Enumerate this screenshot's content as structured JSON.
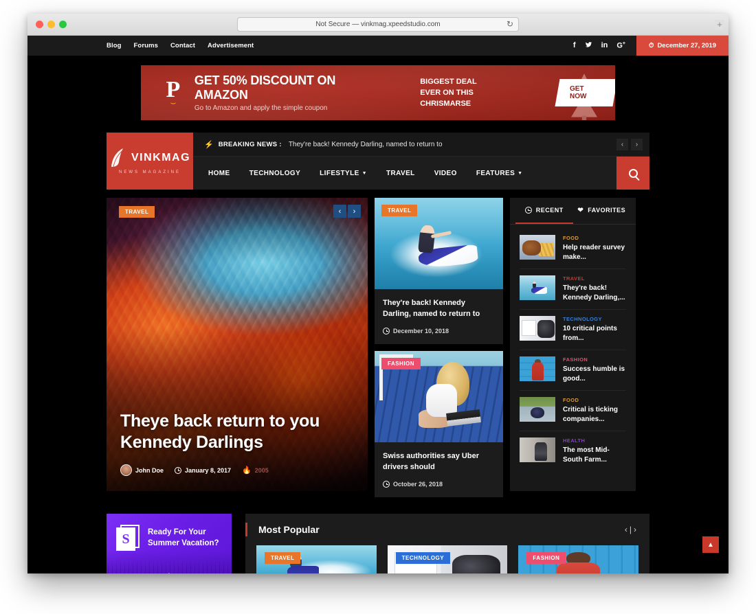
{
  "browser": {
    "url_text": "Not Secure — vinkmag.xpeedstudio.com",
    "reload_icon": "reload-icon",
    "newtab_label": "+"
  },
  "topbar": {
    "links": [
      {
        "label": "Blog"
      },
      {
        "label": "Forums"
      },
      {
        "label": "Contact"
      },
      {
        "label": "Advertisement"
      }
    ],
    "social": [
      {
        "name": "facebook-icon",
        "glyph": "f"
      },
      {
        "name": "twitter-icon",
        "glyph": "🐦"
      },
      {
        "name": "linkedin-icon",
        "glyph": "in"
      },
      {
        "name": "google-plus-icon",
        "glyph": "G+"
      }
    ],
    "date": "December 27, 2019",
    "date_icon": "clock-icon"
  },
  "ad": {
    "brand_glyph": "P",
    "headline": "GET 50% DISCOUNT ON AMAZON",
    "subline": "Go to Amazon and apply the simple coupon",
    "deal_line1": "BIGGEST DEAL",
    "deal_line2": "EVER ON THIS CHRISMARSE",
    "button": "GET NOW"
  },
  "logo": {
    "name": "VINKMAG",
    "tagline": "NEWS MAGAZINE"
  },
  "breaking": {
    "icon": "bolt-icon",
    "label": "BREAKING NEWS :",
    "text": "They're back! Kennedy Darling, named to return to",
    "prev": "‹",
    "next": "›"
  },
  "nav": {
    "items": [
      {
        "label": "HOME",
        "has_dropdown": false
      },
      {
        "label": "TECHNOLOGY",
        "has_dropdown": false
      },
      {
        "label": "LIFESTYLE",
        "has_dropdown": true
      },
      {
        "label": "TRAVEL",
        "has_dropdown": false
      },
      {
        "label": "VIDEO",
        "has_dropdown": false
      },
      {
        "label": "FEATURES",
        "has_dropdown": true
      }
    ],
    "search_icon": "search-icon"
  },
  "hero": {
    "category": "TRAVEL",
    "title": "Theye back return to you Kennedy Darlings",
    "author": "John Doe",
    "date": "January 8, 2017",
    "views": "2005",
    "prev": "‹",
    "next": "›"
  },
  "mid_cards": [
    {
      "category": "TRAVEL",
      "cat_class": "travel",
      "title": "They're back! Kennedy Darling, named to return to",
      "date": "December 10, 2018"
    },
    {
      "category": "FASHION",
      "cat_class": "fashion",
      "title": "Swiss authorities say Uber drivers should",
      "date": "October 26, 2018"
    }
  ],
  "sidebar": {
    "tabs": [
      {
        "label": "RECENT",
        "icon": "clock-icon",
        "active": true
      },
      {
        "label": "FAVORITES",
        "icon": "heart-icon",
        "active": false
      }
    ],
    "items": [
      {
        "category": "FOOD",
        "color": "#d79a3c",
        "title": "Help reader survey make..."
      },
      {
        "category": "TRAVEL",
        "color": "#c9392b",
        "title": "They're back! Kennedy Darling,..."
      },
      {
        "category": "TECHNOLOGY",
        "color": "#3a7fd6",
        "title": "10 critical points from..."
      },
      {
        "category": "FASHION",
        "color": "#e0506e",
        "title": "Success humble is good..."
      },
      {
        "category": "FOOD",
        "color": "#d79a3c",
        "title": "Critical is ticking companies..."
      },
      {
        "category": "HEALTH",
        "color": "#8b3bd4",
        "title": "The most Mid-South Farm..."
      }
    ]
  },
  "promo": {
    "icon_letter": "S",
    "line1": "Ready For Your",
    "line2": "Summer Vacation?"
  },
  "popular": {
    "title": "Most Popular",
    "prev": "‹",
    "divider": "|",
    "next": "›",
    "cards": [
      {
        "category": "TRAVEL",
        "cat_class": "travel"
      },
      {
        "category": "TECHNOLOGY",
        "cat_class": "technology"
      },
      {
        "category": "FASHION",
        "cat_class": "fashion"
      }
    ]
  },
  "scroll_top": {
    "glyph": "▲"
  },
  "colors": {
    "brand_red": "#c93c30",
    "accent_orange": "#e8762a",
    "page_bg": "#000000",
    "panel_bg": "#1c1c1c"
  }
}
